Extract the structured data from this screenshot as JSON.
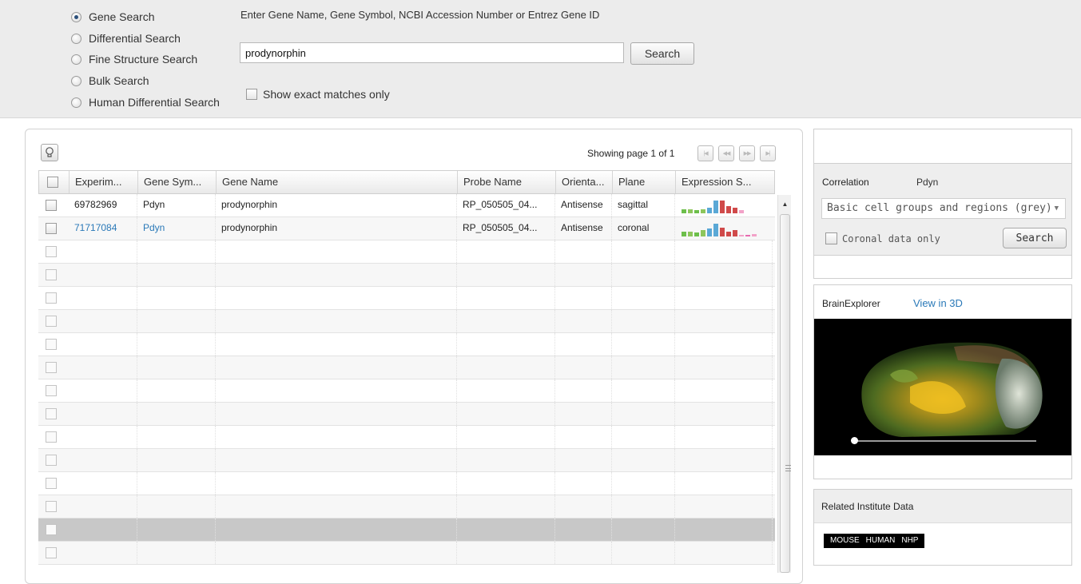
{
  "search_modes": [
    {
      "label": "Gene Search",
      "checked": true
    },
    {
      "label": "Differential Search",
      "checked": false
    },
    {
      "label": "Fine Structure Search",
      "checked": false
    },
    {
      "label": "Bulk Search",
      "checked": false
    },
    {
      "label": "Human Differential Search",
      "checked": false
    }
  ],
  "search": {
    "instructions": "Enter Gene Name, Gene Symbol, NCBI Accession Number or Entrez Gene ID",
    "query": "prodynorphin",
    "button_label": "Search",
    "exact_matches_label": "Show exact matches only"
  },
  "results": {
    "paging_text": "Showing page 1 of 1",
    "columns": [
      "Experim...",
      "Gene Sym...",
      "Gene Name",
      "Probe Name",
      "Orienta...",
      "Plane",
      "Expression S..."
    ],
    "rows": [
      {
        "experiment": "69782969",
        "gene_symbol": "Pdyn",
        "gene_name": "prodynorphin",
        "probe_name": "RP_050505_04...",
        "orientation": "Antisense",
        "plane": "sagittal",
        "link": false,
        "expression": [
          3,
          3,
          2,
          3,
          4,
          9,
          9,
          5,
          4,
          2
        ]
      },
      {
        "experiment": "71717084",
        "gene_symbol": "Pdyn",
        "gene_name": "prodynorphin",
        "probe_name": "RP_050505_04...",
        "orientation": "Antisense",
        "plane": "coronal",
        "link": true,
        "expression": [
          4,
          4,
          3,
          5,
          6,
          10,
          7,
          4,
          5,
          1,
          1,
          2
        ]
      }
    ],
    "empty_rows": 14
  },
  "correlation": {
    "label": "Correlation",
    "gene": "Pdyn",
    "structure_select": "Basic cell groups and regions (grey)",
    "coronal_only_label": "Coronal data only",
    "search_label": "Search"
  },
  "brain_explorer": {
    "title": "BrainExplorer",
    "link_label": "View in 3D",
    "slider_value": 0
  },
  "related": {
    "title": "Related Institute Data",
    "tags": [
      "MOUSE",
      "HUMAN",
      "NHP"
    ]
  },
  "colors": {
    "link": "#2a79b8",
    "panel_bg": "#ececec",
    "expression_palette": [
      "#6dbf4b",
      "#8dc65c",
      "#5aa8d6",
      "#d04a4a",
      "#e66bb0",
      "#f2a2c8"
    ]
  }
}
